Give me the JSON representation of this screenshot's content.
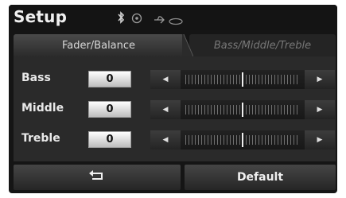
{
  "header": {
    "title": "Setup",
    "status_icons": [
      "bluetooth-icon",
      "disc-icon",
      "usb-icon",
      "aux-icon"
    ]
  },
  "tabs": [
    {
      "label": "Fader/Balance",
      "active": false
    },
    {
      "label": "Bass/Middle/Treble",
      "active": true
    }
  ],
  "rows": [
    {
      "label": "Bass",
      "value": "0",
      "level_fraction": 0.5
    },
    {
      "label": "Middle",
      "value": "0",
      "level_fraction": 0.5
    },
    {
      "label": "Treble",
      "value": "0",
      "level_fraction": 0.5
    }
  ],
  "footer": {
    "back_icon": "return-arrow-icon",
    "default_label": "Default"
  },
  "colors": {
    "background": "#151515",
    "panel": "#2a2a2a",
    "text": "#f0f0f0",
    "inactive_tab_text": "#777777"
  }
}
